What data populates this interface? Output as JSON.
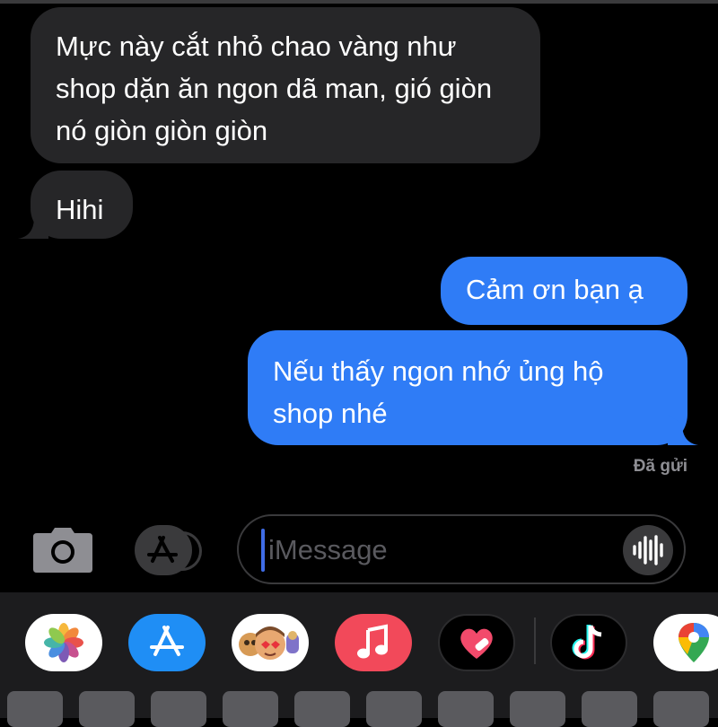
{
  "conversation": {
    "messages": [
      {
        "direction": "incoming",
        "text": "Mực này cắt nhỏ chao vàng như shop dặn ăn ngon dã man, gió giòn nó giòn giòn giòn"
      },
      {
        "direction": "incoming",
        "text": "Hihi"
      },
      {
        "direction": "outgoing",
        "text": "Cảm ơn bạn ạ"
      },
      {
        "direction": "outgoing",
        "text": "Nếu thấy ngon nhớ ủng hộ shop nhé"
      }
    ],
    "delivery_status": "Đã gửi"
  },
  "compose": {
    "placeholder": "iMessage"
  },
  "app_drawer": {
    "apps": [
      {
        "name": "photos-icon"
      },
      {
        "name": "app-store-icon"
      },
      {
        "name": "memoji-stickers-icon"
      },
      {
        "name": "music-icon"
      },
      {
        "name": "digital-touch-icon"
      },
      {
        "name": "tiktok-icon"
      },
      {
        "name": "google-maps-icon"
      }
    ]
  },
  "colors": {
    "incoming_bubble": "#262628",
    "outgoing_bubble": "#2f7cf6",
    "background": "#000000",
    "drawer": "#1c1c1e"
  }
}
